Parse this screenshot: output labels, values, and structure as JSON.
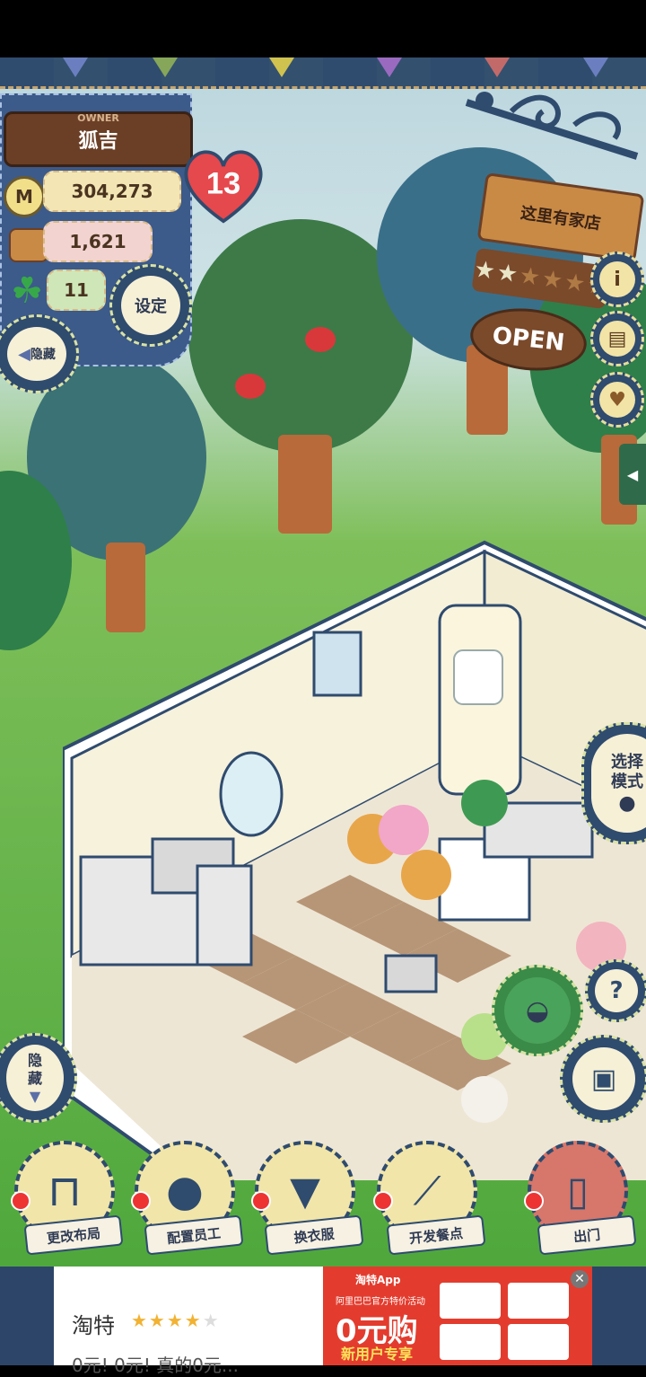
{
  "player": {
    "owner_label": "OWNER",
    "name": "狐吉",
    "level": "13",
    "money": "304,273",
    "food": "1,621",
    "clover": "11"
  },
  "buttons": {
    "settings": "设定",
    "hide_top": "隐藏",
    "hide_side": "隐藏",
    "select_mode": "选择模式"
  },
  "shop": {
    "sign_text": "这里有家店",
    "open_label": "OPEN",
    "rating_stars": 2,
    "rating_max": 6
  },
  "bottom_menu": [
    {
      "label": "更改布局",
      "icon": "table-icon"
    },
    {
      "label": "配置员工",
      "icon": "bear-head-icon"
    },
    {
      "label": "换衣服",
      "icon": "shirt-icon"
    },
    {
      "label": "开发餐点",
      "icon": "knife-icon"
    },
    {
      "label": "出门",
      "icon": "door-icon"
    }
  ],
  "ad": {
    "app_name": "淘特",
    "subtext": "0元! 0元! 真的0元...",
    "banner_app": "淘特App",
    "banner_event": "阿里巴巴官方特价活动",
    "promo": "0元购",
    "promo_sub": "新用户专享"
  },
  "colors": {
    "panel_blue": "#3c5a8a",
    "wood": "#c98a45",
    "heart": "#e5484d",
    "ad_red": "#e33c2e"
  }
}
